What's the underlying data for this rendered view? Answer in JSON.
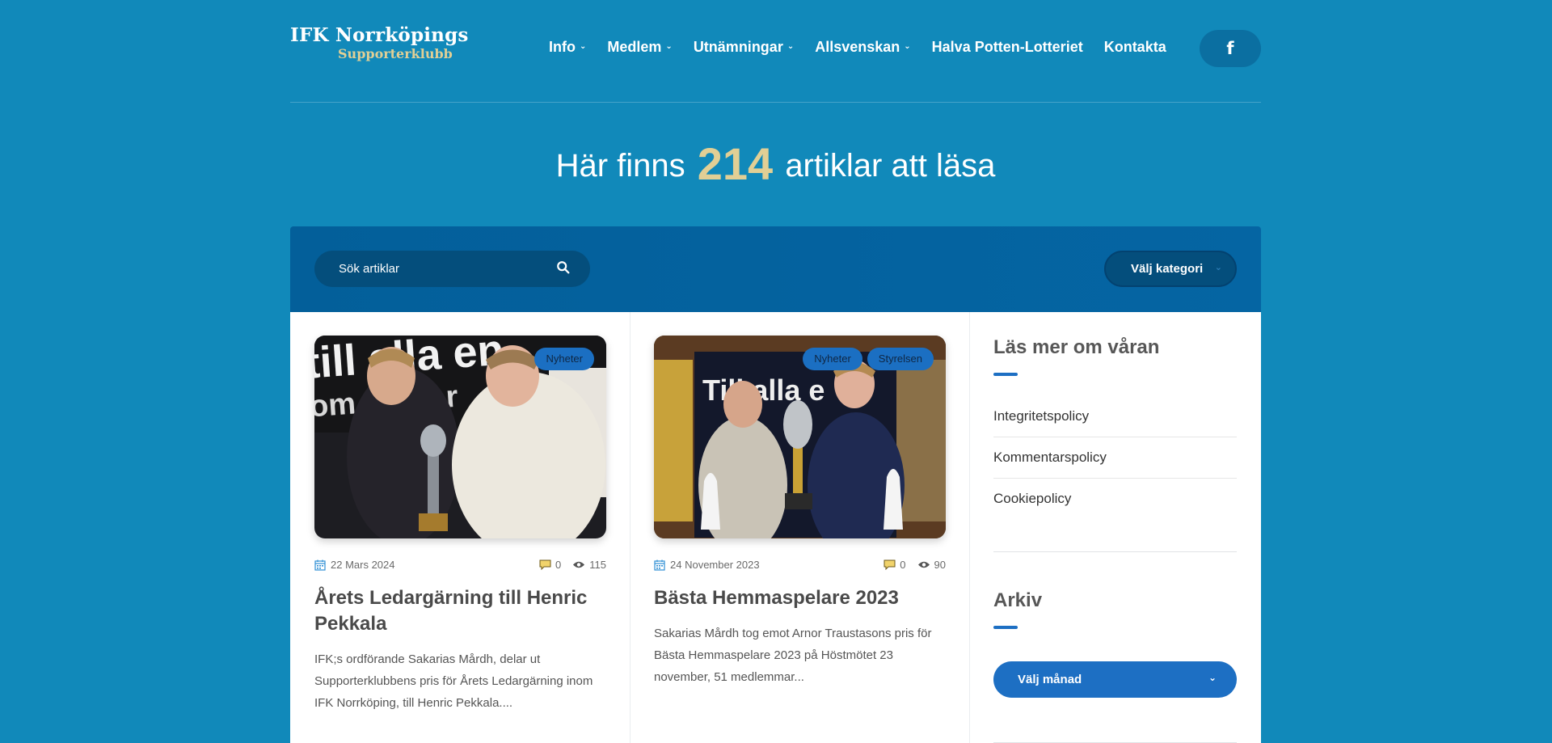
{
  "header": {
    "logo_line1": "IFK Norrköpings",
    "logo_line2": "Supporterklubb",
    "nav": [
      {
        "label": "Info",
        "has_dropdown": true
      },
      {
        "label": "Medlem",
        "has_dropdown": true
      },
      {
        "label": "Utnämningar",
        "has_dropdown": true
      },
      {
        "label": "Allsvenskan",
        "has_dropdown": true
      },
      {
        "label": "Halva Potten-Lotteriet",
        "has_dropdown": false
      },
      {
        "label": "Kontakta",
        "has_dropdown": false
      }
    ],
    "facebook_icon": "f"
  },
  "hero": {
    "prefix": "Här finns",
    "count": "214",
    "suffix": "artiklar att läsa"
  },
  "search": {
    "placeholder": "Sök artiklar",
    "category_label": "Välj kategori"
  },
  "articles": [
    {
      "badges": [
        "Nyheter"
      ],
      "date": "22 Mars 2024",
      "comments": "0",
      "views": "115",
      "title": "Årets Ledargärning till Henric Pekkala",
      "excerpt": "IFK;s ordförande Sakarias Mårdh, delar ut Supporterklubbens pris för Årets Ledargärning inom IFK Norrköping, till Henric Pekkala...."
    },
    {
      "badges": [
        "Nyheter",
        "Styrelsen"
      ],
      "date": "24 November 2023",
      "comments": "0",
      "views": "90",
      "title": "Bästa Hemmaspelare 2023",
      "excerpt": "Sakarias Mårdh tog emot Arnor Traustasons pris för Bästa Hemmaspelare 2023 på Höstmötet 23 november, 51 medlemmar..."
    }
  ],
  "sidebar": {
    "about_title": "Läs mer om våran",
    "links": [
      "Integritetspolicy",
      "Kommentarspolicy",
      "Cookiepolicy"
    ],
    "archive_title": "Arkiv",
    "month_select": "Välj månad"
  },
  "colors": {
    "background": "#1189ba",
    "accent_gold": "#e1cf95",
    "accent_blue": "#1d6fc3"
  }
}
